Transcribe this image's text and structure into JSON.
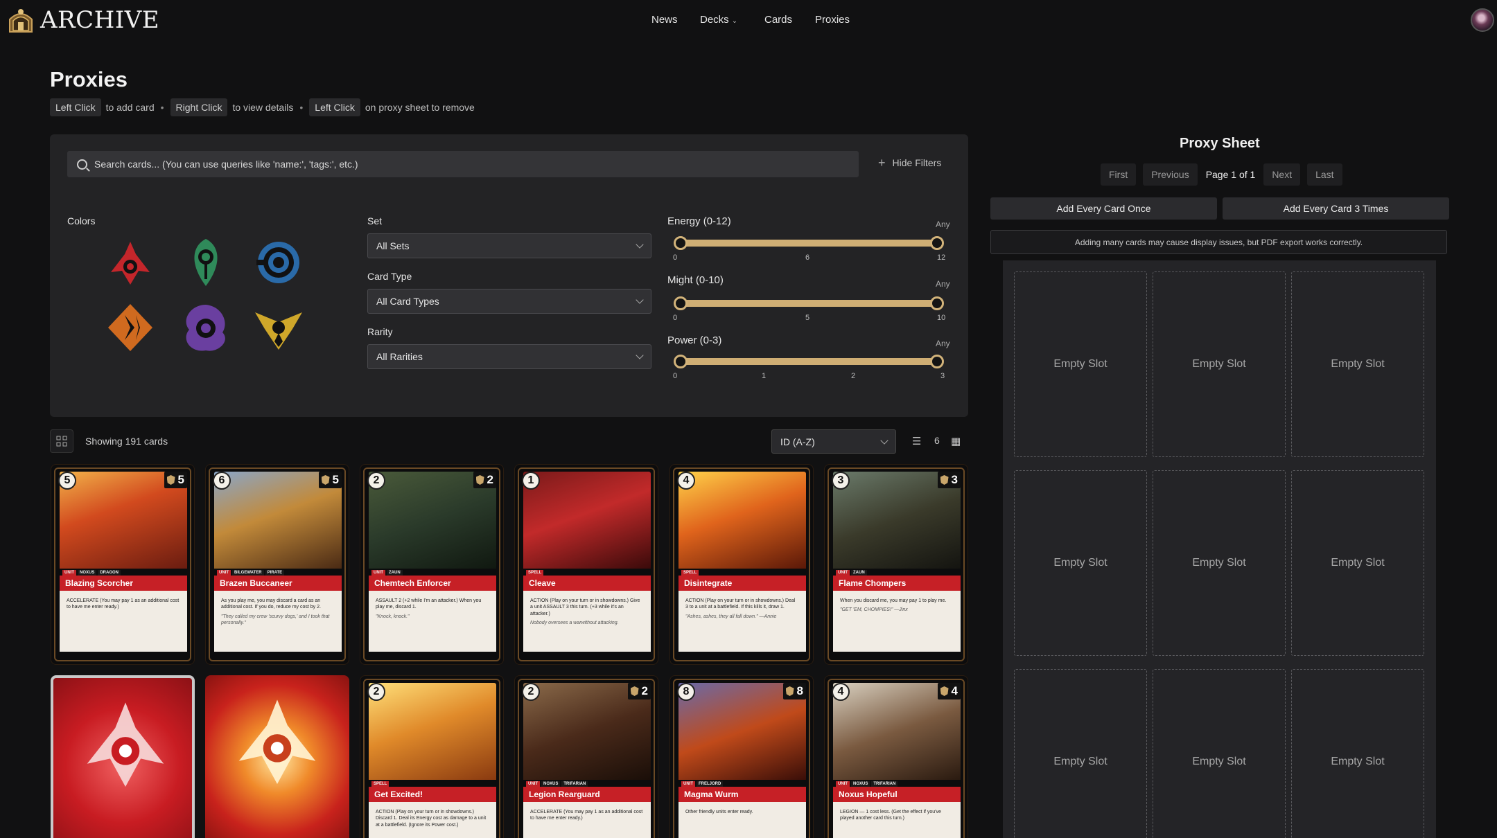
{
  "brand": {
    "name": "ARCHIVE"
  },
  "nav": {
    "news": "News",
    "decks": "Decks",
    "cards": "Cards",
    "proxies": "Proxies"
  },
  "page": {
    "title": "Proxies",
    "hints": [
      {
        "key": "Left Click",
        "text": "to add card"
      },
      {
        "key": "Right Click",
        "text": "to view details"
      },
      {
        "key": "Left Click",
        "text": "on proxy sheet to remove"
      }
    ]
  },
  "filters": {
    "search_placeholder": "Search cards... (You can use queries like 'name:', 'tags:', etc.)",
    "hide_filters": "Hide Filters",
    "colors_label": "Colors",
    "colors": [
      "fury",
      "calm",
      "mind",
      "body",
      "chaos",
      "order"
    ],
    "set_label": "Set",
    "set_value": "All Sets",
    "type_label": "Card Type",
    "type_value": "All Card Types",
    "rarity_label": "Rarity",
    "rarity_value": "All Rarities",
    "energy": {
      "label": "Energy (0-12)",
      "any": "Any",
      "ticks": [
        "0",
        "6",
        "12"
      ],
      "min": 0,
      "max": 12
    },
    "might": {
      "label": "Might (0-10)",
      "any": "Any",
      "ticks": [
        "0",
        "5",
        "10"
      ],
      "min": 0,
      "max": 10
    },
    "power": {
      "label": "Power (0-3)",
      "any": "Any",
      "ticks": [
        "0",
        "1",
        "2",
        "3"
      ],
      "min": 0,
      "max": 3
    }
  },
  "results": {
    "showing": "Showing 191 cards",
    "sort": "ID (A-Z)",
    "columns": "6"
  },
  "cards": [
    {
      "name": "Blazing Scorcher",
      "cost": "5",
      "might": "5",
      "tags": [
        "UNIT",
        "NOXUS",
        "DRAGON"
      ],
      "text": "ACCELERATE (You may pay 1 as an additional cost to have me enter ready.)",
      "flavor": ""
    },
    {
      "name": "Brazen Buccaneer",
      "cost": "6",
      "might": "5",
      "tags": [
        "UNIT",
        "BILGEWATER",
        "PIRATE"
      ],
      "text": "As you play me, you may discard a card as an additional cost. If you do, reduce my cost by 2.",
      "flavor": "\"They called my crew 'scurvy dogs,' and I took that personally.\""
    },
    {
      "name": "Chemtech Enforcer",
      "cost": "2",
      "might": "2",
      "tags": [
        "UNIT",
        "ZAUN"
      ],
      "text": "ASSAULT 2 (+2 while I'm an attacker.) When you play me, discard 1.",
      "flavor": "\"Knock, knock.\""
    },
    {
      "name": "Cleave",
      "cost": "1",
      "might": "",
      "tags": [
        "SPELL"
      ],
      "text": "ACTION (Play on your turn or in showdowns.) Give a unit ASSAULT 3 this turn. (+3 while it's an attacker.)",
      "flavor": "Nobody oversees a warwithout attacking."
    },
    {
      "name": "Disintegrate",
      "cost": "4",
      "might": "",
      "tags": [
        "SPELL"
      ],
      "text": "ACTION (Play on your turn or in showdowns.) Deal 3 to a unit at a battlefield. If this kills it, draw 1.",
      "flavor": "\"Ashes, ashes, they all fall down.\" —Annie"
    },
    {
      "name": "Flame Chompers",
      "cost": "3",
      "might": "3",
      "tags": [
        "UNIT",
        "ZAUN"
      ],
      "text": "When you discard me, you may pay 1 to play me.",
      "flavor": "\"GET 'EM, CHOMPIES!\" —Jinx"
    }
  ],
  "cards_row2": [
    {
      "name": "Fury Rune",
      "kind": "rune"
    },
    {
      "name": "Fury Rune",
      "kind": "rune-alt"
    },
    {
      "name": "Get Excited!",
      "cost": "2",
      "might": "",
      "tags": [
        "SPELL"
      ],
      "text": "ACTION (Play on your turn or in showdowns.) Discard 1. Deal its Energy cost as damage to a unit at a battlefield. (Ignore its Power cost.)"
    },
    {
      "name": "Legion Rearguard",
      "cost": "2",
      "might": "2",
      "tags": [
        "UNIT",
        "NOXUS",
        "TRIFARIAN"
      ],
      "text": "ACCELERATE (You may pay 1 as an additional cost to have me enter ready.)"
    },
    {
      "name": "Magma Wurm",
      "cost": "8",
      "might": "8",
      "tags": [
        "UNIT",
        "FRELJORD"
      ],
      "text": "Other friendly units enter ready."
    },
    {
      "name": "Noxus Hopeful",
      "cost": "4",
      "might": "4",
      "tags": [
        "UNIT",
        "NOXUS",
        "TRIFARIAN"
      ],
      "text": "LEGION — 1 cost less. (Get the effect if you've played another card this turn.)"
    }
  ],
  "proxy": {
    "title": "Proxy Sheet",
    "first": "First",
    "previous": "Previous",
    "page": "Page 1 of 1",
    "next": "Next",
    "last": "Last",
    "add_once": "Add Every Card Once",
    "add_three": "Add Every Card 3 Times",
    "warning": "Adding many cards may cause display issues, but PDF export works correctly.",
    "empty_slot": "Empty Slot"
  }
}
